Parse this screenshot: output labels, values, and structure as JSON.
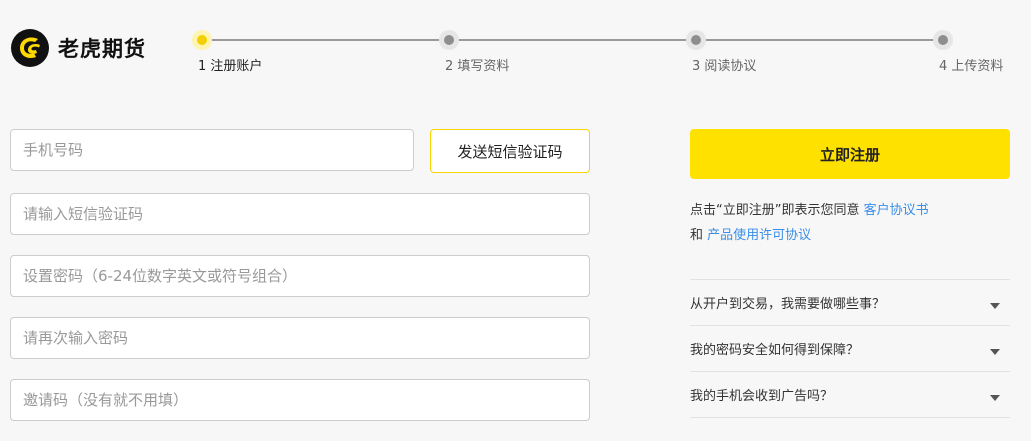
{
  "brand": {
    "name": "老虎期货",
    "logo_icon": "tiger-logo-icon",
    "accent": "#ffe100"
  },
  "steps": [
    {
      "label": "1 注册账户",
      "active": true
    },
    {
      "label": "2 填写资料",
      "active": false
    },
    {
      "label": "3 阅读协议",
      "active": false
    },
    {
      "label": "4 上传资料",
      "active": false
    }
  ],
  "form": {
    "phone_placeholder": "手机号码",
    "sms_button": "发送短信验证码",
    "sms_code_placeholder": "请输入短信验证码",
    "password_placeholder": "设置密码（6-24位数字英文或符号组合）",
    "password_confirm_placeholder": "请再次输入密码",
    "invite_placeholder": "邀请码（没有就不用填）"
  },
  "register": {
    "button": "立即注册",
    "agree_prefix": "点击“立即注册”即表示您同意",
    "agree_link1": "客户协议书",
    "agree_and": "和",
    "agree_link2": "产品使用许可协议"
  },
  "faq": [
    "从开户到交易，我需要做哪些事？",
    "我的密码安全如何得到保障？",
    "我的手机会收到广告吗？"
  ]
}
